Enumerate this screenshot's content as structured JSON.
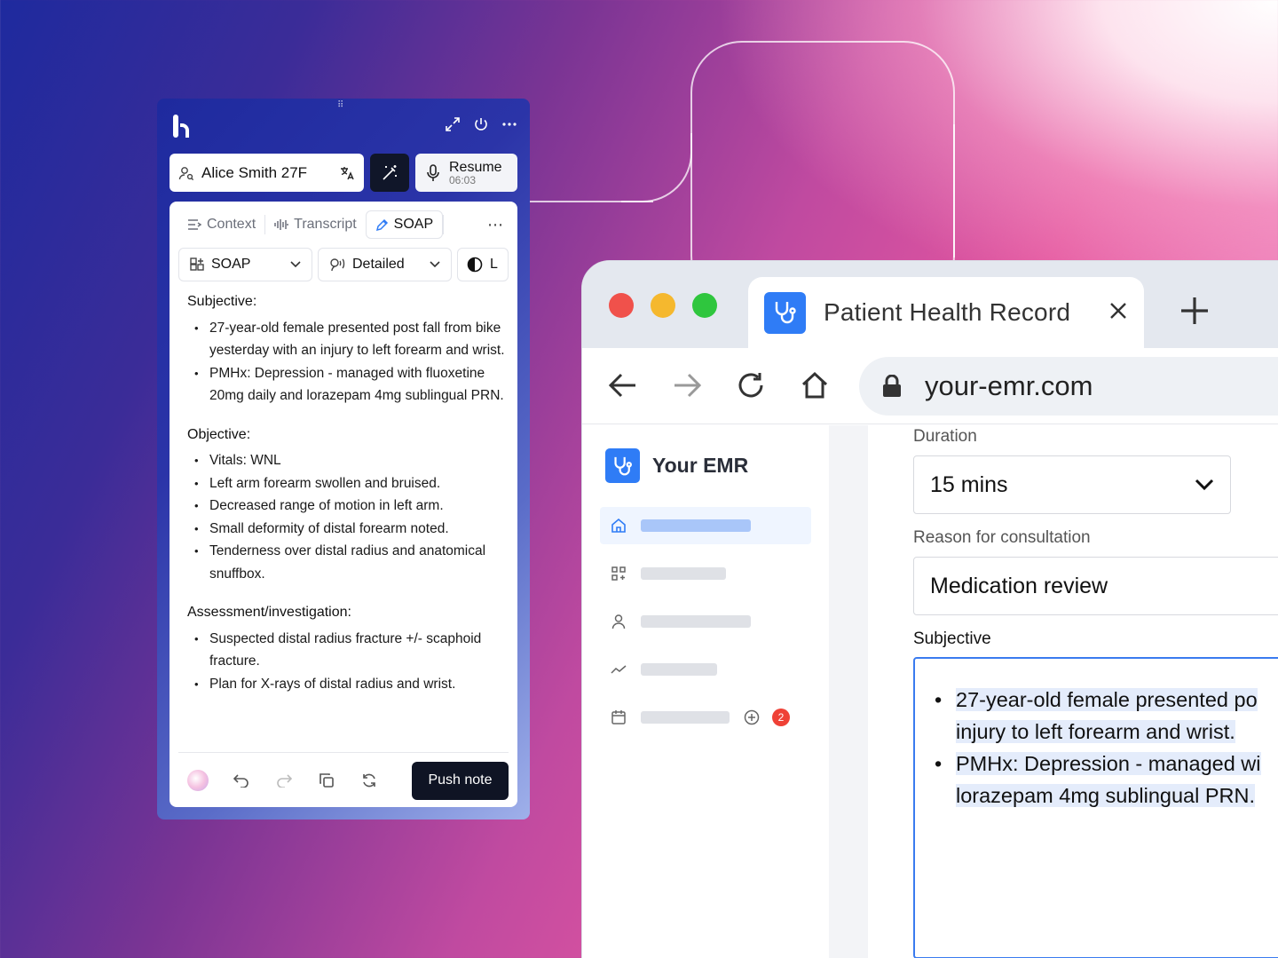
{
  "widget": {
    "patient_name": "Alice Smith 27F",
    "resume_label": "Resume",
    "resume_time": "06:03",
    "tabs": {
      "context": "Context",
      "transcript": "Transcript",
      "soap": "SOAP"
    },
    "selectors": {
      "template": "SOAP",
      "detail": "Detailed",
      "language": "L"
    },
    "note": {
      "subjective_title": "Subjective:",
      "subjective": [
        "27-year-old female presented post fall from bike yesterday with an injury to left forearm and wrist.",
        "PMHx: Depression - managed with fluoxetine 20mg daily and lorazepam 4mg sublingual PRN."
      ],
      "objective_title": "Objective:",
      "objective": [
        "Vitals: WNL",
        "Left arm forearm swollen and bruised.",
        "Decreased range of motion in left arm.",
        "Small deformity of distal forearm noted.",
        "Tenderness over distal radius and anatomical snuffbox."
      ],
      "assessment_title": "Assessment/investigation:",
      "assessment": [
        "Suspected distal radius fracture +/- scaphoid fracture.",
        "Plan for X-rays of distal radius and wrist."
      ]
    },
    "push_note": "Push note"
  },
  "browser": {
    "tab_title": "Patient Health Record",
    "url": "your-emr.com",
    "emr_name": "Your EMR",
    "badge_count": "2",
    "form": {
      "duration_label": "Duration",
      "duration_value": "15 mins",
      "reason_label": "Reason for consultation",
      "reason_value": "Medication review",
      "subjective_label": "Subjective",
      "subjective_lines": [
        "27-year-old female presented po",
        "injury to left forearm and wrist.",
        "PMHx: Depression - managed wi",
        "lorazepam 4mg sublingual PRN."
      ]
    }
  },
  "colors": {
    "accent_blue": "#2f7cf6",
    "dark_button": "#0f1424",
    "traffic_red": "#f0514b",
    "traffic_yellow": "#f5b82e",
    "traffic_green": "#2fc63e",
    "badge_red": "#ef4136"
  }
}
